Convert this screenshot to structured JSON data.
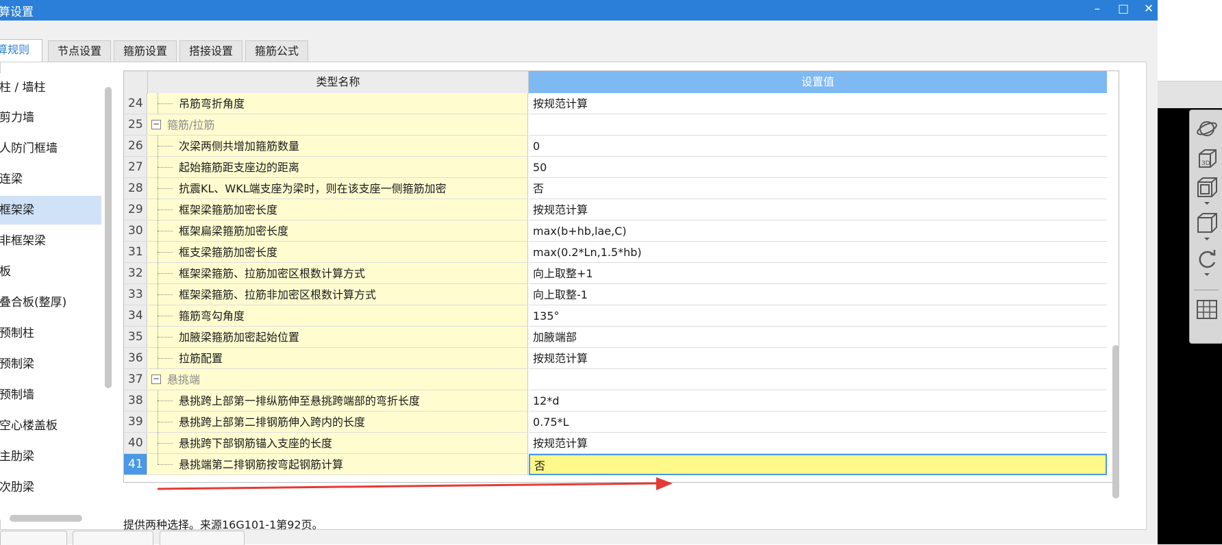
{
  "window": {
    "title": "算设置",
    "minimize": "–",
    "maximize": "□",
    "close": "✕"
  },
  "tabs": [
    {
      "label": "计算规则",
      "active": true
    },
    {
      "label": "节点设置",
      "active": false
    },
    {
      "label": "箍筋设置",
      "active": false
    },
    {
      "label": "搭接设置",
      "active": false
    },
    {
      "label": "箍筋公式",
      "active": false
    }
  ],
  "tree": {
    "items": [
      "柱 / 墙柱",
      "剪力墙",
      "人防门框墙",
      "连梁",
      "框架梁",
      "非框架梁",
      "板",
      "叠合板(整厚)",
      "预制柱",
      "预制梁",
      "预制墙",
      "空心楼盖板",
      "主肋梁",
      "次肋梁"
    ],
    "selected_index": 4
  },
  "grid": {
    "header_name": "类型名称",
    "header_value": "设置值",
    "rows": [
      {
        "num": "24",
        "type": "item",
        "name": "吊筋弯折角度",
        "value": "按规范计算"
      },
      {
        "num": "25",
        "type": "group",
        "toggle": "−",
        "name": "箍筋/拉筋",
        "value": ""
      },
      {
        "num": "26",
        "type": "item",
        "name": "次梁两侧共增加箍筋数量",
        "value": "0"
      },
      {
        "num": "27",
        "type": "item",
        "name": "起始箍筋距支座边的距离",
        "value": "50"
      },
      {
        "num": "28",
        "type": "item",
        "name": "抗震KL、WKL端支座为梁时，则在该支座一侧箍筋加密",
        "value": "否"
      },
      {
        "num": "29",
        "type": "item",
        "name": "框架梁箍筋加密长度",
        "value": "按规范计算"
      },
      {
        "num": "30",
        "type": "item",
        "name": "框架扁梁箍筋加密长度",
        "value": "max(b+hb,lae,C)"
      },
      {
        "num": "31",
        "type": "item",
        "name": "框支梁箍筋加密长度",
        "value": "max(0.2*Ln,1.5*hb)"
      },
      {
        "num": "32",
        "type": "item",
        "name": "框架梁箍筋、拉筋加密区根数计算方式",
        "value": "向上取整+1"
      },
      {
        "num": "33",
        "type": "item",
        "name": "框架梁箍筋、拉筋非加密区根数计算方式",
        "value": "向上取整-1"
      },
      {
        "num": "34",
        "type": "item",
        "name": "箍筋弯勾角度",
        "value": "135°"
      },
      {
        "num": "35",
        "type": "item",
        "name": "加腋梁箍筋加密起始位置",
        "value": "加腋端部"
      },
      {
        "num": "36",
        "type": "item",
        "name": "拉筋配置",
        "value": "按规范计算"
      },
      {
        "num": "37",
        "type": "group",
        "toggle": "−",
        "name": "悬挑端",
        "value": ""
      },
      {
        "num": "38",
        "type": "item",
        "name": "悬挑跨上部第一排纵筋伸至悬挑跨端部的弯折长度",
        "value": "12*d"
      },
      {
        "num": "39",
        "type": "item",
        "name": "悬挑跨上部第二排钢筋伸入跨内的长度",
        "value": "0.75*L"
      },
      {
        "num": "40",
        "type": "item",
        "name": "悬挑跨下部钢筋锚入支座的长度",
        "value": "按规范计算"
      },
      {
        "num": "41",
        "type": "item",
        "name": "悬挑端第二排钢筋按弯起钢筋计算",
        "value": "否",
        "selected": true
      }
    ]
  },
  "description": "提供两种选择。来源16G101-1第92页。",
  "toolbar_3d": {
    "icons": [
      "orbit-icon",
      "view-3d-icon",
      "box-view-icon",
      "cube-icon",
      "rotate-icon",
      "grid-settings-icon"
    ],
    "cube_label": "3D"
  },
  "annotation_color": "#e53935"
}
